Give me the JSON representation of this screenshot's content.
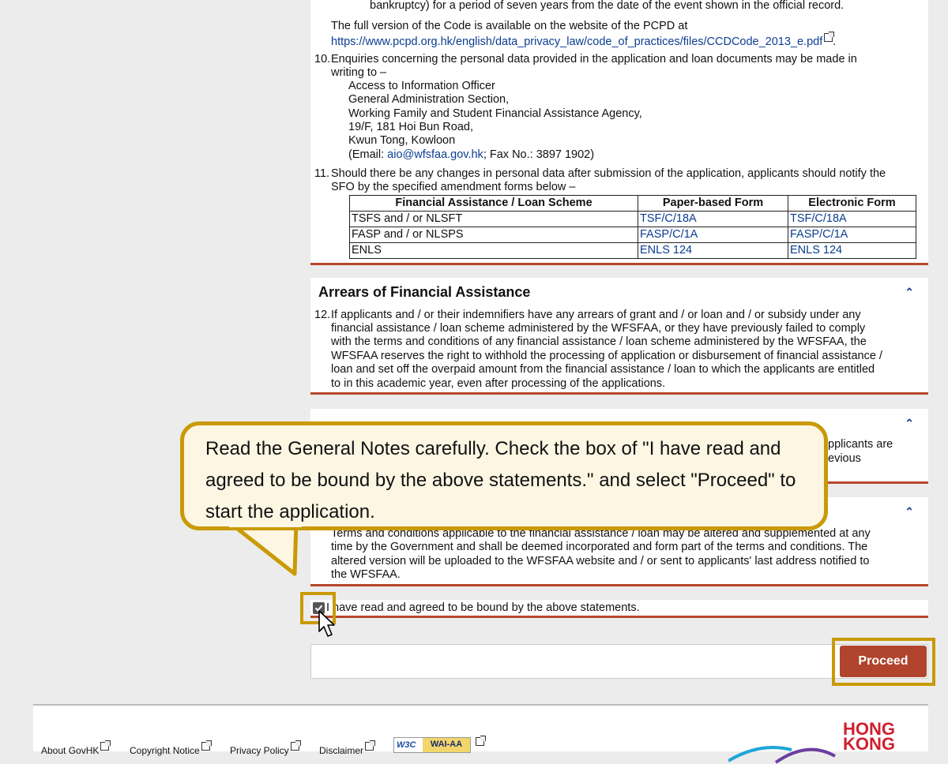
{
  "section_privacy": {
    "top_text": "bankruptcy) for a period of seven years from the date of the event shown in the official record.",
    "code_intro": "The full version of the Code is available on the website of the PCPD at",
    "code_link": "https://www.pcpd.org.hk/english/data_privacy_law/code_of_practices/files/CCDCode_2013_e.pdf",
    "item10_num": "10.",
    "item10_line1": "Enquiries concerning the personal data provided in the application and loan documents may be made in",
    "item10_line2": "writing to –",
    "address": [
      "Access to Information Officer",
      "General Administration Section,",
      "Working Family and Student Financial Assistance Agency,",
      "19/F, 181 Hoi Bun Road,",
      "Kwun Tong, Kowloon"
    ],
    "email_prefix": "(Email: ",
    "email": "aio@wfsfaa.gov.hk",
    "fax": "; Fax No.: 3897 1902)",
    "item11_num": "11.",
    "item11_line1": "Should there be any changes in personal data after submission of the application, applicants should notify the",
    "item11_line2": "SFO by the specified amendment forms below –",
    "table": {
      "headers": [
        "Financial Assistance / Loan Scheme",
        "Paper-based Form",
        "Electronic Form"
      ],
      "rows": [
        [
          "TSFS and / or NLSFT",
          "TSF/C/18A",
          "TSF/C/18A"
        ],
        [
          "FASP and / or NLSPS",
          "FASP/C/1A",
          "FASP/C/1A"
        ],
        [
          "ENLS",
          "ENLS 124",
          "ENLS 124"
        ]
      ]
    }
  },
  "section_arrears": {
    "title": "Arrears of Financial Assistance",
    "item_num": "12.",
    "lines": [
      "If applicants and / or their indemnifiers have any arrears of grant and / or loan and / or subsidy under any",
      "financial assistance / loan scheme administered by the WFSFAA, or they have previously failed to comply",
      "with the terms and conditions of any financial assistance / loan scheme administered by the WFSFAA, the",
      "WFSFAA reserves the right to withhold the processing of application or disbursement of financial assistance /",
      "loan and set off the overpaid amount from the financial assistance / loan to which the applicants are entitled",
      "to in this academic year, even after processing of the applications."
    ]
  },
  "section_hidden1": {
    "right_line1": "pplicants are",
    "right_line2": "evious"
  },
  "section_terms": {
    "first_line": "Terms and conditions applicable to the financial assistance / loan may be altered and supplemented at any",
    "lines": [
      "time by the Government and shall be deemed incorporated and form part of the terms and conditions. The",
      "altered version will be uploaded to the WFSFAA website and / or sent to applicants' last address notified to",
      "the WFSFAA."
    ]
  },
  "agreement": {
    "label": "I have read and agreed to be bound by the above statements.",
    "checked": true
  },
  "callout": {
    "text": "Read the General Notes carefully. Check the box of \"I have read and agreed to be bound by the above statements.\" and select \"Proceed\" to start the application."
  },
  "buttons": {
    "proceed": "Proceed"
  },
  "footer": {
    "links": [
      "About GovHK",
      "Copyright Notice",
      "Privacy Policy",
      "Disclaimer"
    ],
    "wai_badge": "WAI-AA",
    "w3c": "W3C",
    "logo_line1": "HONG",
    "logo_line2": "KONG"
  },
  "colors": {
    "accent_red": "#b0442d",
    "highlight_gold": "#c99a06",
    "link_blue": "#0b3d91"
  }
}
